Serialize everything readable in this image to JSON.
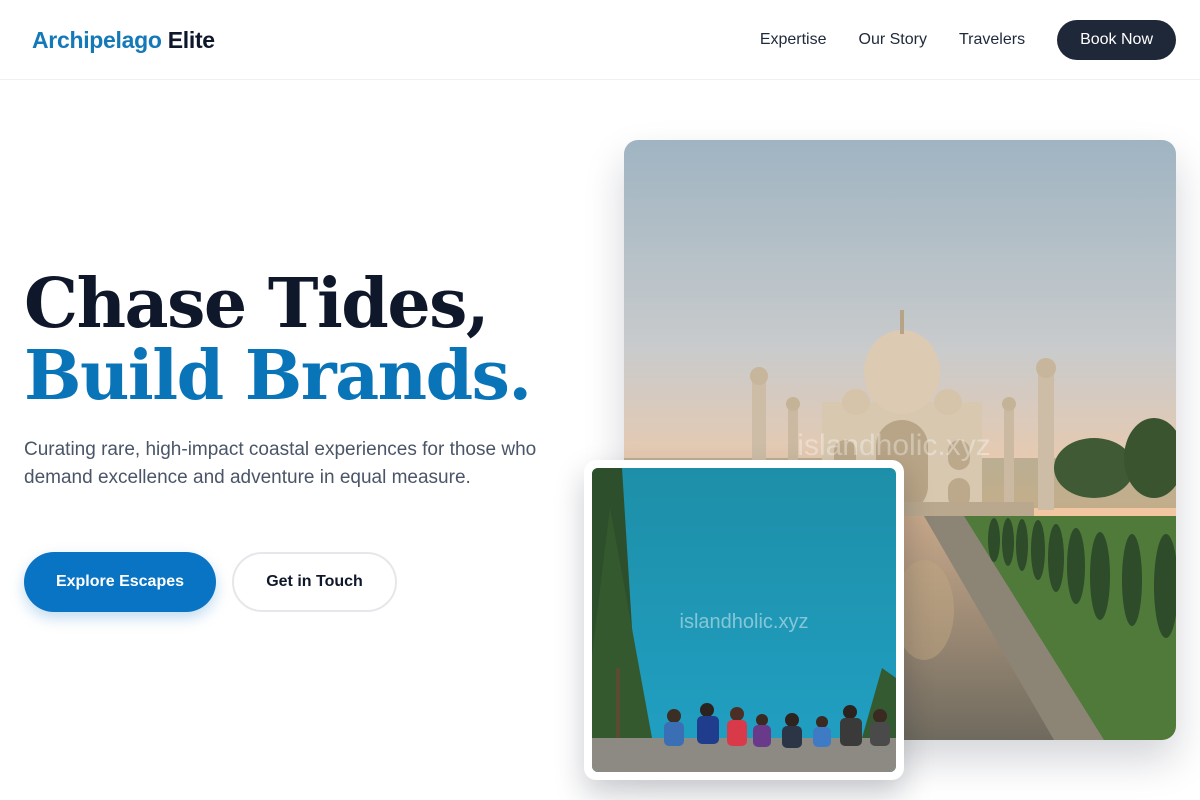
{
  "brand": {
    "part1": "Archipelago",
    "part2": "Elite",
    "accent": "#1479b8"
  },
  "nav": {
    "links": [
      "Expertise",
      "Our Story",
      "Travelers"
    ],
    "cta": "Book Now"
  },
  "hero": {
    "title_line1": "Chase Tides,",
    "title_line2": "Build Brands.",
    "subtitle": "Curating rare, high-impact coastal experiences for those who demand excellence and adventure in equal measure.",
    "primary_cta": "Explore Escapes",
    "secondary_cta": "Get in Touch"
  },
  "images": {
    "main": {
      "subject": "Taj Mahal at sunset with reflecting pool",
      "watermark": "islandholic.xyz"
    },
    "inset": {
      "subject": "Hikers sitting by a turquoise lake",
      "watermark": "islandholic.xyz"
    }
  },
  "colors": {
    "dark": "#0f172a",
    "primary": "#0a74c4",
    "button_dark": "#1e2838"
  }
}
